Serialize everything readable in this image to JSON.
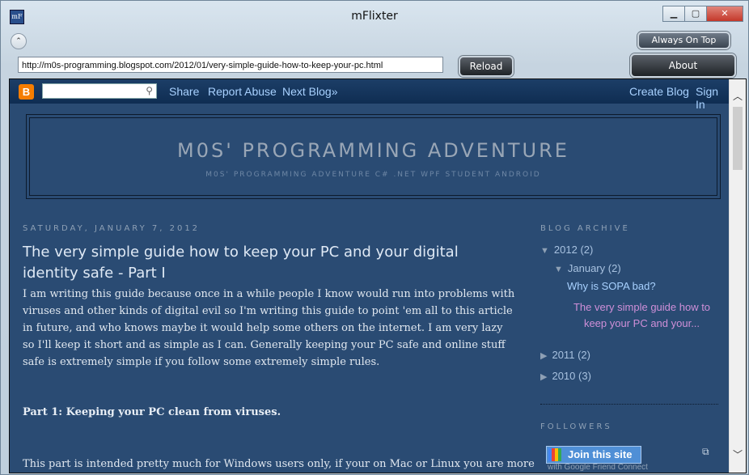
{
  "window": {
    "title": "mFlixter",
    "icon_text": "mF",
    "minimize": "▁",
    "maximize": "▢",
    "close": "✕"
  },
  "toolbar": {
    "collapse_glyph": "⌃",
    "always_on_top_label": "Always On Top",
    "about_label": "About",
    "url": "http://m0s-programming.blogspot.com/2012/01/very-simple-guide-how-to-keep-your-pc.html",
    "reload_label": "Reload"
  },
  "navbar": {
    "logo": "B",
    "search_icon": "⚲",
    "links": {
      "share": "Share",
      "report_abuse": "Report Abuse",
      "next_blog": "Next Blog»",
      "create_blog": "Create Blog",
      "sign_in": "Sign In"
    }
  },
  "blog": {
    "title": "M0S' PROGRAMMING ADVENTURE",
    "description": "M0S' PROGRAMMING ADVENTURE C# .NET WPF STUDENT ANDROID"
  },
  "post": {
    "date": "SATURDAY, JANUARY 7, 2012",
    "title": "The very simple guide how to keep your PC and your digital identity safe - Part I",
    "intro": "I am writing this guide because once in a while people I know would run into problems with viruses and other kinds of digital evil so I'm writing this guide to point 'em all to this article in future, and who knows maybe it would help some others on the internet. I am very lazy so I'll keep it short and as simple as I can. Generally keeping your PC safe and online stuff safe is extremely simple if you follow some extremely simple rules.",
    "part1_heading": "Part 1: Keeping your PC clean from viruses.",
    "part1_text": "This part is intended pretty much for Windows users only, if your on Mac or Linux you are more"
  },
  "sidebar": {
    "archive_heading": "BLOG ARCHIVE",
    "archive": {
      "y2012": {
        "label": "2012",
        "count": "(2)"
      },
      "january": {
        "label": "January",
        "count": "(2)"
      },
      "post1": "Why is SOPA bad?",
      "post2": "The very simple guide how to keep your PC and your...",
      "y2011": {
        "label": "2011",
        "count": "(2)"
      },
      "y2010": {
        "label": "2010",
        "count": "(3)"
      }
    },
    "followers_heading": "FOLLOWERS",
    "join_label": "Join this site",
    "gfc_label": "with Google Friend Connect",
    "popout_icon": "⧉"
  },
  "colors": {
    "page_bg": "#2a4b73",
    "link": "#a8d1ff",
    "visited_link": "#cf8fd8"
  }
}
